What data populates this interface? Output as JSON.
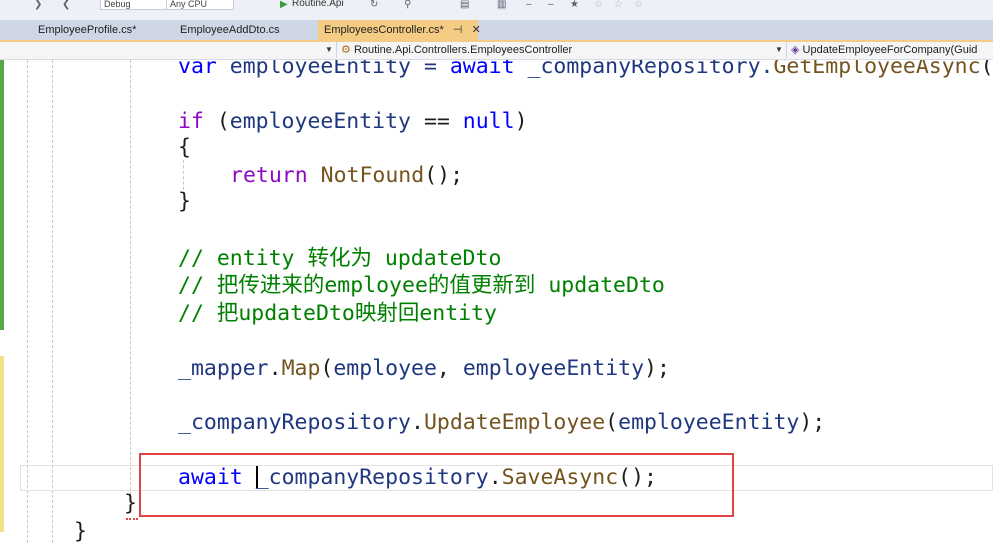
{
  "toolbar": {
    "config_value": "Debug",
    "platform_value": "Any CPU",
    "run_target": "Routine.Api"
  },
  "tabs": [
    {
      "label": "EmployeeProfile.cs*",
      "active": false
    },
    {
      "label": "EmployeeAddDto.cs",
      "active": false
    },
    {
      "label": "EmployeesController.cs*",
      "active": true
    }
  ],
  "tab_pin_glyph": "⊣",
  "tab_close_glyph": "✕",
  "navbar": {
    "class_path": "Routine.Api.Controllers.EmployeesController",
    "member": "UpdateEmployeeForCompany(Guid"
  },
  "code": {
    "line1": {
      "kw": "var",
      "a": " employeeEntity = ",
      "kw2": "await",
      "b": " _companyRepository.",
      "fn": "GetEmployeeAsync",
      "c": "("
    },
    "line2": {
      "kw": "if",
      "a": " (",
      "v": "employeeEntity",
      "b": " == ",
      "kw2": "null",
      "c": ")"
    },
    "line3": "{",
    "line4": {
      "kw": "return",
      "a": " ",
      "fn": "NotFound",
      "b": "();"
    },
    "line5": "}",
    "comment1": "// entity 转化为 updateDto",
    "comment2": "// 把传进来的employee的值更新到 updateDto",
    "comment3": "// 把updateDto映射回entity",
    "line6": {
      "v0": "_mapper",
      "a": ".",
      "fn": "Map",
      "b": "(",
      "v1": "employee",
      "c": ", ",
      "v2": "employeeEntity",
      "d": ");"
    },
    "line7": {
      "v0": "_companyRepository",
      "a": ".",
      "fn": "UpdateEmployee",
      "b": "(",
      "v1": "employeeEntity",
      "c": ");"
    },
    "line8": {
      "kw": "await",
      "a": " ",
      "v0": "_companyRepository",
      "b": ".",
      "fn": "SaveAsync",
      "c": "();"
    },
    "line9": "}",
    "line10": "}"
  },
  "colors": {
    "keyword": "#0000ff",
    "method": "#74531f",
    "variable": "#1f377f",
    "comment": "#008000",
    "highlight_box": "#e04444",
    "active_tab": "#f5cc84"
  }
}
